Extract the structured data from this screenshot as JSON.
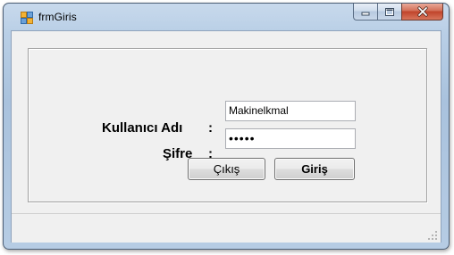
{
  "window": {
    "title": "frmGiris",
    "icon": "form-icon"
  },
  "caption_buttons": {
    "minimize_icon": "minimize-icon",
    "maximize_icon": "maximize-icon",
    "close_icon": "close-icon"
  },
  "form": {
    "username_label": "Kullanıcı Adı",
    "username_colon": ":",
    "password_label": "Şifre",
    "password_colon": ":",
    "username_value": "Makinelkmal",
    "password_value": "•••••",
    "exit_button": "Çıkış",
    "login_button": "Giriş"
  },
  "colors": {
    "window_frame": "#b9cfe6",
    "close_button": "#c0432a",
    "client_background": "#f0f0f0"
  }
}
